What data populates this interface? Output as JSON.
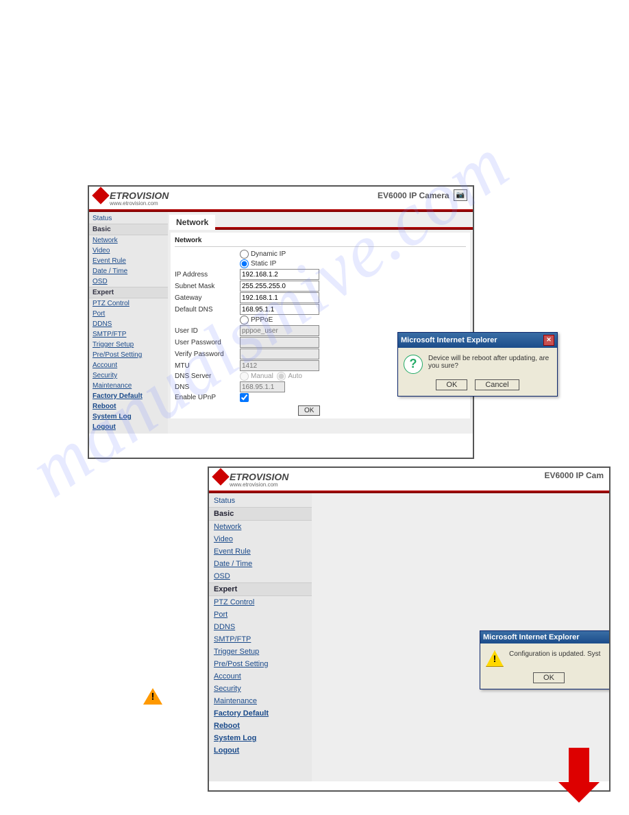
{
  "watermark": "manualsmive.com",
  "brand": {
    "name": "ETROVISION",
    "url": "www.etrovision.com"
  },
  "camera_model": "EV6000 IP Camera",
  "camera_model_short": "EV6000 IP Cam",
  "sidebar": {
    "status": "Status",
    "basic": "Basic",
    "basic_items": [
      "Network",
      "Video",
      "Event Rule",
      "Date / Time",
      "OSD"
    ],
    "expert": "Expert",
    "expert_items": [
      "PTZ Control",
      "Port",
      "DDNS",
      "SMTP/FTP",
      "Trigger Setup",
      "Pre/Post Setting",
      "Account",
      "Security",
      "Maintenance"
    ],
    "bottom": [
      "Factory Default",
      "Reboot",
      "System Log",
      "Logout"
    ]
  },
  "page": {
    "tab": "Network",
    "section": "Network",
    "fields": {
      "dynamic_ip": "Dynamic IP",
      "static_ip": "Static IP",
      "ip_address": "IP Address",
      "ip_address_v": "192.168.1.2",
      "subnet": "Subnet Mask",
      "subnet_v": "255.255.255.0",
      "gateway": "Gateway",
      "gateway_v": "192.168.1.1",
      "defdns": "Default DNS",
      "defdns_v": "168.95.1.1",
      "pppoe": "PPPoE",
      "userid": "User ID",
      "userid_ph": "pppoe_user",
      "userpw": "User Password",
      "verifypw": "Verify Password",
      "mtu": "MTU",
      "mtu_ph": "1412",
      "dnssrv": "DNS Server",
      "manual": "Manual",
      "auto": "Auto",
      "dns": "DNS",
      "dns_ph": "168.95.1.1",
      "upnp": "Enable UPnP",
      "ok": "OK"
    }
  },
  "dialog1": {
    "title": "Microsoft Internet Explorer",
    "msg": "Device will be reboot after updating, are you sure?",
    "ok": "OK",
    "cancel": "Cancel"
  },
  "dialog2": {
    "title": "Microsoft Internet Explorer",
    "msg": "Configuration is updated. Syst",
    "ok": "OK"
  }
}
